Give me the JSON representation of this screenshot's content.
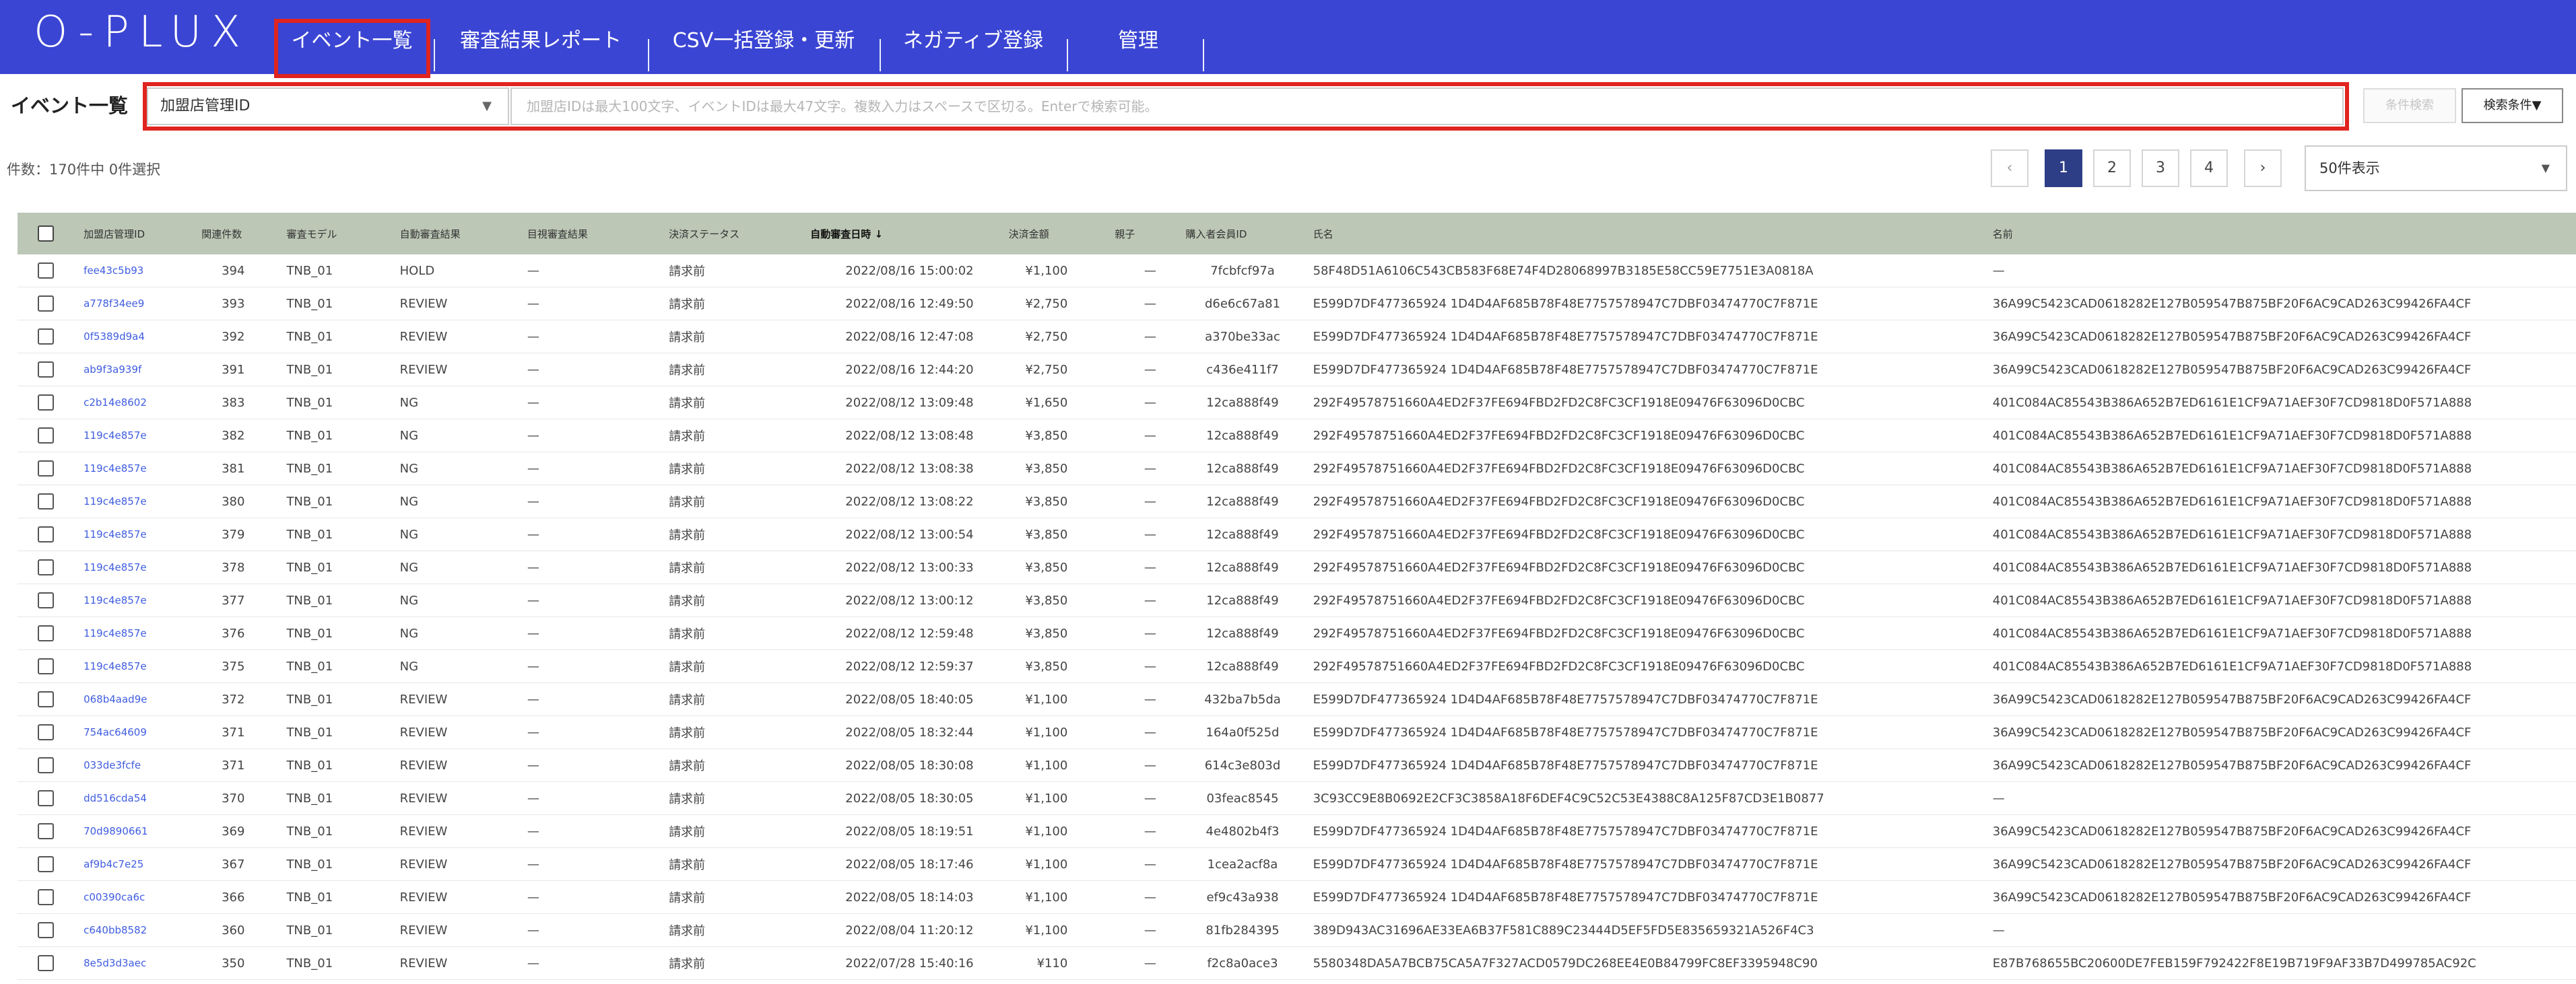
{
  "header": {
    "logo": "O-PLUX",
    "nav": [
      {
        "label": "イベント一覧"
      },
      {
        "label": "審査結果レポート"
      },
      {
        "label": "CSV一括登録・更新"
      },
      {
        "label": "ネガティブ登録"
      },
      {
        "label": "管理"
      }
    ]
  },
  "filter": {
    "page_label": "イベント一覧",
    "select_value": "加盟店管理ID",
    "search_placeholder": "加盟店IDは最大100文字、イベントIDは最大47文字。複数入力はスペースで区切る。Enterで検索可能。",
    "search_button": "条件検索",
    "condition_button": "検索条件▼"
  },
  "pagination": {
    "count_text": "件数：170件中 0件選択",
    "prev": "‹",
    "next": "›",
    "pages": [
      "1",
      "2",
      "3",
      "4"
    ],
    "active_page": "1",
    "per_page": "50件表示"
  },
  "table": {
    "columns": [
      "加盟店管理ID",
      "関連件数",
      "審査モデル",
      "自動審査結果",
      "目視審査結果",
      "決済ステータス",
      "自動審査日時 ↓",
      "決済金額",
      "親子",
      "購入者会員ID",
      "氏名",
      "名前"
    ],
    "rows": [
      [
        "fee43c5b93",
        "394",
        "TNB_01",
        "HOLD",
        "—",
        "請求前",
        "2022/08/16 15:00:02",
        "¥1,100",
        "—",
        "7fcbfcf97a",
        "58F48D51A6106C543CB583F68E74F4D28068997B3185E58CC59E7751E3A0818A",
        "—"
      ],
      [
        "a778f34ee9",
        "393",
        "TNB_01",
        "REVIEW",
        "—",
        "請求前",
        "2022/08/16 12:49:50",
        "¥2,750",
        "—",
        "d6e6c67a81",
        "E599D7DF477365924 1D4D4AF685B78F48E7757578947C7DBF03474770C7F871E",
        "36A99C5423CAD0618282E127B059547B875BF20F6AC9CAD263C99426FA4CF"
      ],
      [
        "0f5389d9a4",
        "392",
        "TNB_01",
        "REVIEW",
        "—",
        "請求前",
        "2022/08/16 12:47:08",
        "¥2,750",
        "—",
        "a370be33ac",
        "E599D7DF477365924 1D4D4AF685B78F48E7757578947C7DBF03474770C7F871E",
        "36A99C5423CAD0618282E127B059547B875BF20F6AC9CAD263C99426FA4CF"
      ],
      [
        "ab9f3a939f",
        "391",
        "TNB_01",
        "REVIEW",
        "—",
        "請求前",
        "2022/08/16 12:44:20",
        "¥2,750",
        "—",
        "c436e411f7",
        "E599D7DF477365924 1D4D4AF685B78F48E7757578947C7DBF03474770C7F871E",
        "36A99C5423CAD0618282E127B059547B875BF20F6AC9CAD263C99426FA4CF"
      ],
      [
        "c2b14e8602",
        "383",
        "TNB_01",
        "NG",
        "—",
        "請求前",
        "2022/08/12 13:09:48",
        "¥1,650",
        "—",
        "12ca888f49",
        "292F49578751660A4ED2F37FE694FBD2FD2C8FC3CF1918E09476F63096D0CBC",
        "401C084AC85543B386A652B7ED6161E1CF9A71AEF30F7CD9818D0F571A888"
      ],
      [
        "119c4e857e",
        "382",
        "TNB_01",
        "NG",
        "—",
        "請求前",
        "2022/08/12 13:08:48",
        "¥3,850",
        "—",
        "12ca888f49",
        "292F49578751660A4ED2F37FE694FBD2FD2C8FC3CF1918E09476F63096D0CBC",
        "401C084AC85543B386A652B7ED6161E1CF9A71AEF30F7CD9818D0F571A888"
      ],
      [
        "119c4e857e",
        "381",
        "TNB_01",
        "NG",
        "—",
        "請求前",
        "2022/08/12 13:08:38",
        "¥3,850",
        "—",
        "12ca888f49",
        "292F49578751660A4ED2F37FE694FBD2FD2C8FC3CF1918E09476F63096D0CBC",
        "401C084AC85543B386A652B7ED6161E1CF9A71AEF30F7CD9818D0F571A888"
      ],
      [
        "119c4e857e",
        "380",
        "TNB_01",
        "NG",
        "—",
        "請求前",
        "2022/08/12 13:08:22",
        "¥3,850",
        "—",
        "12ca888f49",
        "292F49578751660A4ED2F37FE694FBD2FD2C8FC3CF1918E09476F63096D0CBC",
        "401C084AC85543B386A652B7ED6161E1CF9A71AEF30F7CD9818D0F571A888"
      ],
      [
        "119c4e857e",
        "379",
        "TNB_01",
        "NG",
        "—",
        "請求前",
        "2022/08/12 13:00:54",
        "¥3,850",
        "—",
        "12ca888f49",
        "292F49578751660A4ED2F37FE694FBD2FD2C8FC3CF1918E09476F63096D0CBC",
        "401C084AC85543B386A652B7ED6161E1CF9A71AEF30F7CD9818D0F571A888"
      ],
      [
        "119c4e857e",
        "378",
        "TNB_01",
        "NG",
        "—",
        "請求前",
        "2022/08/12 13:00:33",
        "¥3,850",
        "—",
        "12ca888f49",
        "292F49578751660A4ED2F37FE694FBD2FD2C8FC3CF1918E09476F63096D0CBC",
        "401C084AC85543B386A652B7ED6161E1CF9A71AEF30F7CD9818D0F571A888"
      ],
      [
        "119c4e857e",
        "377",
        "TNB_01",
        "NG",
        "—",
        "請求前",
        "2022/08/12 13:00:12",
        "¥3,850",
        "—",
        "12ca888f49",
        "292F49578751660A4ED2F37FE694FBD2FD2C8FC3CF1918E09476F63096D0CBC",
        "401C084AC85543B386A652B7ED6161E1CF9A71AEF30F7CD9818D0F571A888"
      ],
      [
        "119c4e857e",
        "376",
        "TNB_01",
        "NG",
        "—",
        "請求前",
        "2022/08/12 12:59:48",
        "¥3,850",
        "—",
        "12ca888f49",
        "292F49578751660A4ED2F37FE694FBD2FD2C8FC3CF1918E09476F63096D0CBC",
        "401C084AC85543B386A652B7ED6161E1CF9A71AEF30F7CD9818D0F571A888"
      ],
      [
        "119c4e857e",
        "375",
        "TNB_01",
        "NG",
        "—",
        "請求前",
        "2022/08/12 12:59:37",
        "¥3,850",
        "—",
        "12ca888f49",
        "292F49578751660A4ED2F37FE694FBD2FD2C8FC3CF1918E09476F63096D0CBC",
        "401C084AC85543B386A652B7ED6161E1CF9A71AEF30F7CD9818D0F571A888"
      ],
      [
        "068b4aad9e",
        "372",
        "TNB_01",
        "REVIEW",
        "—",
        "請求前",
        "2022/08/05 18:40:05",
        "¥1,100",
        "—",
        "432ba7b5da",
        "E599D7DF477365924 1D4D4AF685B78F48E7757578947C7DBF03474770C7F871E",
        "36A99C5423CAD0618282E127B059547B875BF20F6AC9CAD263C99426FA4CF"
      ],
      [
        "754ac64609",
        "371",
        "TNB_01",
        "REVIEW",
        "—",
        "請求前",
        "2022/08/05 18:32:44",
        "¥1,100",
        "—",
        "164a0f525d",
        "E599D7DF477365924 1D4D4AF685B78F48E7757578947C7DBF03474770C7F871E",
        "36A99C5423CAD0618282E127B059547B875BF20F6AC9CAD263C99426FA4CF"
      ],
      [
        "033de3fcfe",
        "371",
        "TNB_01",
        "REVIEW",
        "—",
        "請求前",
        "2022/08/05 18:30:08",
        "¥1,100",
        "—",
        "614c3e803d",
        "E599D7DF477365924 1D4D4AF685B78F48E7757578947C7DBF03474770C7F871E",
        "36A99C5423CAD0618282E127B059547B875BF20F6AC9CAD263C99426FA4CF"
      ],
      [
        "dd516cda54",
        "370",
        "TNB_01",
        "REVIEW",
        "—",
        "請求前",
        "2022/08/05 18:30:05",
        "¥1,100",
        "—",
        "03feac8545",
        "3C93CC9E8B0692E2CF3C3858A18F6DEF4C9C52C53E4388C8A125F87CD3E1B0877",
        "—"
      ],
      [
        "70d9890661",
        "369",
        "TNB_01",
        "REVIEW",
        "—",
        "請求前",
        "2022/08/05 18:19:51",
        "¥1,100",
        "—",
        "4e4802b4f3",
        "E599D7DF477365924 1D4D4AF685B78F48E7757578947C7DBF03474770C7F871E",
        "36A99C5423CAD0618282E127B059547B875BF20F6AC9CAD263C99426FA4CF"
      ],
      [
        "af9b4c7e25",
        "367",
        "TNB_01",
        "REVIEW",
        "—",
        "請求前",
        "2022/08/05 18:17:46",
        "¥1,100",
        "—",
        "1cea2acf8a",
        "E599D7DF477365924 1D4D4AF685B78F48E7757578947C7DBF03474770C7F871E",
        "36A99C5423CAD0618282E127B059547B875BF20F6AC9CAD263C99426FA4CF"
      ],
      [
        "c00390ca6c",
        "366",
        "TNB_01",
        "REVIEW",
        "—",
        "請求前",
        "2022/08/05 18:14:03",
        "¥1,100",
        "—",
        "ef9c43a938",
        "E599D7DF477365924 1D4D4AF685B78F48E7757578947C7DBF03474770C7F871E",
        "36A99C5423CAD0618282E127B059547B875BF20F6AC9CAD263C99426FA4CF"
      ],
      [
        "c640bb8582",
        "360",
        "TNB_01",
        "REVIEW",
        "—",
        "請求前",
        "2022/08/04 11:20:12",
        "¥1,100",
        "—",
        "81fb284395",
        "389D943AC31696AE33EA6B37F581C889C23444D5EF5FD5E835659321A526F4C3",
        "—"
      ],
      [
        "8e5d3d3aec",
        "350",
        "TNB_01",
        "REVIEW",
        "—",
        "請求前",
        "2022/07/28 15:40:16",
        "¥110",
        "—",
        "f2c8a0ace3",
        "5580348DA5A7BCB75CA5A7F327ACD0579DC268EE4E0B84799FC8EF3395948C90",
        "E87B768655BC20600DE7FEB159F792422F8E19B719F9AF33B7D499785AC92C"
      ]
    ]
  },
  "colors": {
    "header_bg": "#3b45d3",
    "table_header_bg": "#bcc7b6",
    "highlight": "#e0241f",
    "link": "#3f5de0",
    "active_page": "#2d3d86"
  }
}
